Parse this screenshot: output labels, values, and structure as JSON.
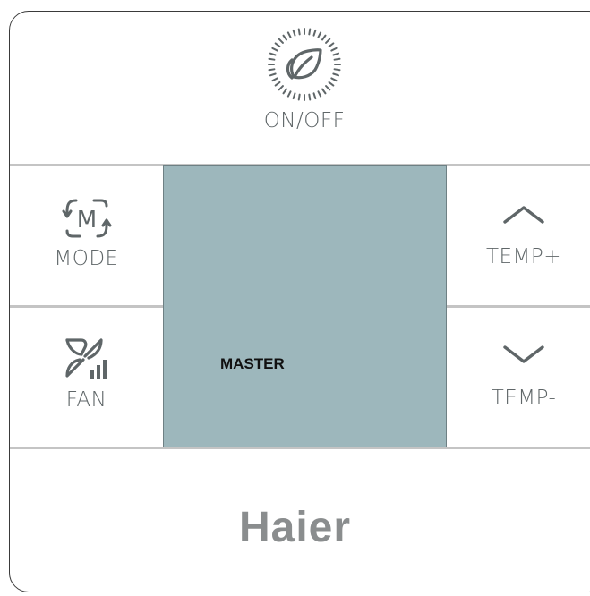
{
  "power": {
    "label": "ON/OFF",
    "icon": "eco-leaf-power-icon"
  },
  "mode": {
    "label": "MODE",
    "icon": "mode-m-cycle-icon"
  },
  "fan": {
    "label": "FAN",
    "icon": "fan-speed-icon"
  },
  "temp_up": {
    "label": "TEMP+",
    "icon": "chevron-up-icon"
  },
  "temp_down": {
    "label": "TEMP-",
    "icon": "chevron-down-icon"
  },
  "display": {
    "text": "MASTER"
  },
  "brand": {
    "name": "Haier"
  },
  "colors": {
    "screen": "#9db7bc",
    "label": "#5f6668",
    "brand": "#8a8d8e",
    "divider": "#c4c4c4"
  }
}
